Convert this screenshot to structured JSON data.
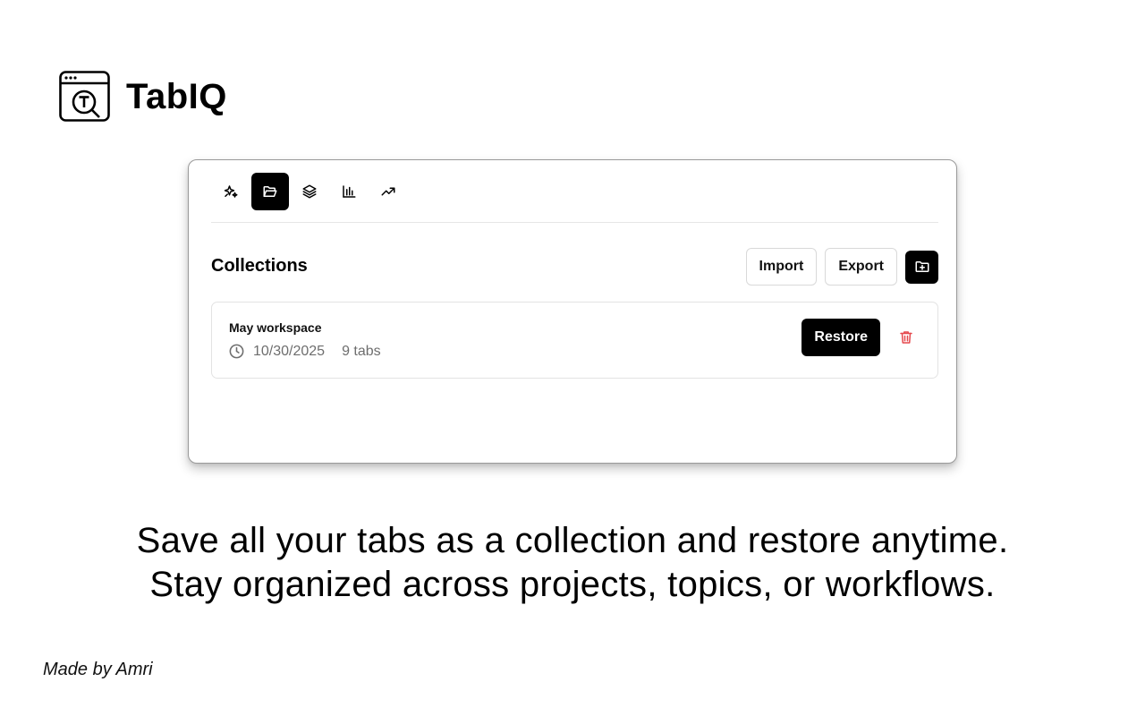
{
  "brand": {
    "name": "TabIQ",
    "logo_icon": "browser-search-icon"
  },
  "toolbar": {
    "items": [
      {
        "icon": "sparkles-icon",
        "active": false
      },
      {
        "icon": "folder-open-icon",
        "active": true
      },
      {
        "icon": "layers-icon",
        "active": false
      },
      {
        "icon": "bar-chart-icon",
        "active": false
      },
      {
        "icon": "trending-up-icon",
        "active": false
      }
    ]
  },
  "collections": {
    "title": "Collections",
    "import_label": "Import",
    "export_label": "Export",
    "new_icon": "folder-plus-icon",
    "items": [
      {
        "name": "May workspace",
        "date": "10/30/2025",
        "tabs": "9 tabs",
        "restore_label": "Restore"
      }
    ]
  },
  "tagline": {
    "line1": "Save all your tabs as a collection and restore anytime.",
    "line2": "Stay organized across projects, topics, or workflows."
  },
  "credit": "Made by Amri",
  "colors": {
    "accent": "#000000",
    "danger": "#e5484d",
    "muted": "#6e6e6e"
  }
}
